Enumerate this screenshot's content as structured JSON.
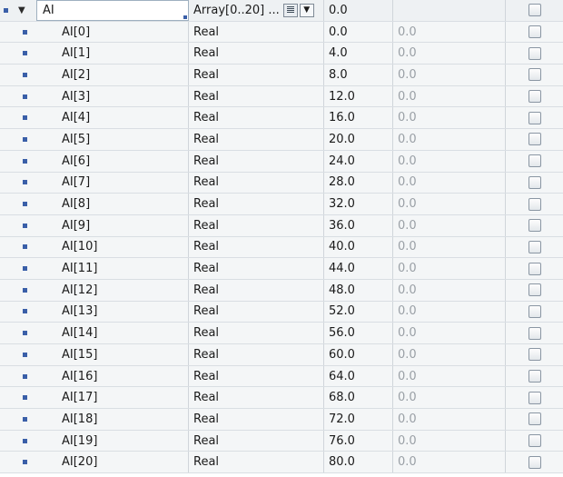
{
  "root": {
    "name": "AI",
    "type": "Array[0..20] ...",
    "start_value": "0.0",
    "expand_icon": "triangle-down-icon"
  },
  "elements": [
    {
      "name": "AI[0]",
      "type": "Real",
      "start": "0.0",
      "monitor": "0.0"
    },
    {
      "name": "AI[1]",
      "type": "Real",
      "start": "4.0",
      "monitor": "0.0"
    },
    {
      "name": "AI[2]",
      "type": "Real",
      "start": "8.0",
      "monitor": "0.0"
    },
    {
      "name": "AI[3]",
      "type": "Real",
      "start": "12.0",
      "monitor": "0.0"
    },
    {
      "name": "AI[4]",
      "type": "Real",
      "start": "16.0",
      "monitor": "0.0"
    },
    {
      "name": "AI[5]",
      "type": "Real",
      "start": "20.0",
      "monitor": "0.0"
    },
    {
      "name": "AI[6]",
      "type": "Real",
      "start": "24.0",
      "monitor": "0.0"
    },
    {
      "name": "AI[7]",
      "type": "Real",
      "start": "28.0",
      "monitor": "0.0"
    },
    {
      "name": "AI[8]",
      "type": "Real",
      "start": "32.0",
      "monitor": "0.0"
    },
    {
      "name": "AI[9]",
      "type": "Real",
      "start": "36.0",
      "monitor": "0.0"
    },
    {
      "name": "AI[10]",
      "type": "Real",
      "start": "40.0",
      "monitor": "0.0"
    },
    {
      "name": "AI[11]",
      "type": "Real",
      "start": "44.0",
      "monitor": "0.0"
    },
    {
      "name": "AI[12]",
      "type": "Real",
      "start": "48.0",
      "monitor": "0.0"
    },
    {
      "name": "AI[13]",
      "type": "Real",
      "start": "52.0",
      "monitor": "0.0"
    },
    {
      "name": "AI[14]",
      "type": "Real",
      "start": "56.0",
      "monitor": "0.0"
    },
    {
      "name": "AI[15]",
      "type": "Real",
      "start": "60.0",
      "monitor": "0.0"
    },
    {
      "name": "AI[16]",
      "type": "Real",
      "start": "64.0",
      "monitor": "0.0"
    },
    {
      "name": "AI[17]",
      "type": "Real",
      "start": "68.0",
      "monitor": "0.0"
    },
    {
      "name": "AI[18]",
      "type": "Real",
      "start": "72.0",
      "monitor": "0.0"
    },
    {
      "name": "AI[19]",
      "type": "Real",
      "start": "76.0",
      "monitor": "0.0"
    },
    {
      "name": "AI[20]",
      "type": "Real",
      "start": "80.0",
      "monitor": "0.0"
    }
  ],
  "colors": {
    "marker": "#3a5fa8",
    "grid": "#d9dee3",
    "row_bg": "#f4f6f7",
    "monitor_text": "#9aa0a6"
  }
}
